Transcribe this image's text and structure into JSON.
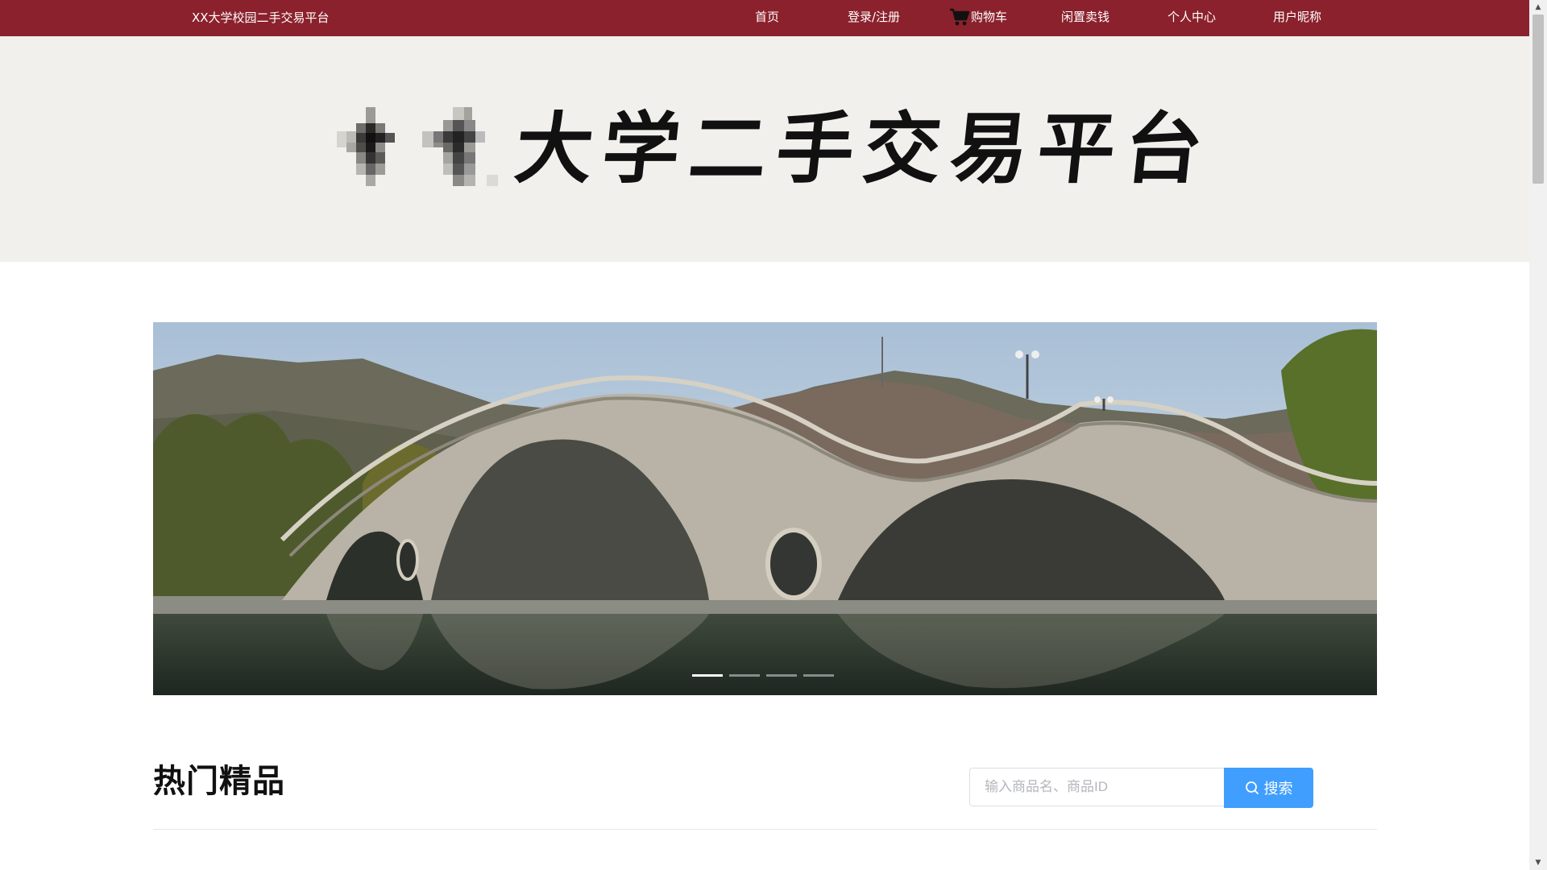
{
  "header": {
    "site_name": "XX大学校园二手交易平台",
    "nav": [
      {
        "label": "首页",
        "icon": ""
      },
      {
        "label": "登录/注册",
        "icon": ""
      },
      {
        "label": "购物车",
        "icon": "cart-icon"
      },
      {
        "label": "闲置卖钱",
        "icon": ""
      },
      {
        "label": "个人中心",
        "icon": ""
      },
      {
        "label": "用户昵称",
        "icon": ""
      }
    ],
    "bar_color": "#8b212c"
  },
  "banner": {
    "title": "大学二手交易平台",
    "logo_note": "pixelated-logo"
  },
  "carousel": {
    "image": "stone-arch-bridge-over-river",
    "indicator_count": 4,
    "active_index": 0
  },
  "section": {
    "title": "热门精品"
  },
  "search": {
    "placeholder": "输入商品名、商品ID",
    "value": "",
    "button_label": "搜索",
    "button_color": "#409eff"
  }
}
